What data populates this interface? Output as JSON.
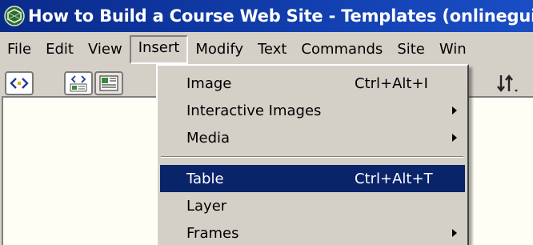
{
  "window": {
    "title": "How to Build a Course Web Site - Templates (onlineguid"
  },
  "menubar": {
    "items": [
      "File",
      "Edit",
      "View",
      "Insert",
      "Modify",
      "Text",
      "Commands",
      "Site",
      "Win"
    ],
    "open_menu": "Insert"
  },
  "toolbar": {
    "buttons": [
      "code-view-icon",
      "split-view-icon",
      "design-view-icon"
    ],
    "right_icon": "sort-arrows-icon"
  },
  "insert_menu": {
    "items": [
      {
        "label": "Image",
        "shortcut": "Ctrl+Alt+I",
        "submenu": false
      },
      {
        "label": "Interactive Images",
        "shortcut": "",
        "submenu": true
      },
      {
        "label": "Media",
        "shortcut": "",
        "submenu": true
      },
      {
        "label": "Table",
        "shortcut": "Ctrl+Alt+T",
        "submenu": false,
        "highlighted": true
      },
      {
        "label": "Layer",
        "shortcut": "",
        "submenu": false
      },
      {
        "label": "Frames",
        "shortcut": "",
        "submenu": true
      }
    ]
  },
  "colors": {
    "titlebar": "#0a246a",
    "highlight": "#0a246a",
    "chrome": "#d4d0c8"
  }
}
